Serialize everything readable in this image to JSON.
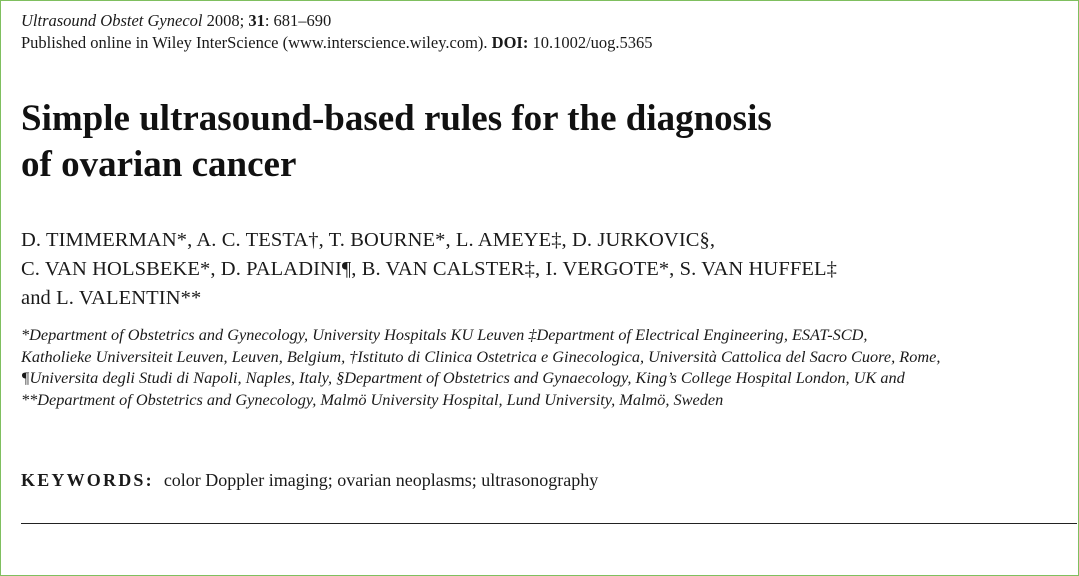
{
  "citation": {
    "journal": "Ultrasound Obstet Gynecol",
    "year": " 2008; ",
    "volume": "31",
    "pages": ": 681–690",
    "published": "Published online in Wiley InterScience (www.interscience.wiley.com). ",
    "doi_label": "DOI:",
    "doi_value": " 10.1002/uog.5365"
  },
  "title": {
    "line1": "Simple ultrasound-based rules for the diagnosis",
    "line2": "of ovarian cancer"
  },
  "authors": {
    "line1": "D. TIMMERMAN*, A. C. TESTA†, T. BOURNE*, L. AMEYE‡, D. JURKOVIC§,",
    "line2": "C. VAN HOLSBEKE*, D. PALADINI¶, B. VAN CALSTER‡, I. VERGOTE*, S. VAN HUFFEL‡",
    "line3": "and L. VALENTIN**"
  },
  "affiliations": {
    "line1": "*Department of Obstetrics and Gynecology, University Hospitals KU Leuven ‡Department of Electrical Engineering, ESAT-SCD,",
    "line2": "Katholieke Universiteit Leuven, Leuven, Belgium, †Istituto di Clinica Ostetrica e Ginecologica, Università Cattolica del Sacro Cuore, Rome,",
    "line3": "¶Universita degli Studi di Napoli, Naples, Italy, §Department of Obstetrics and Gynaecology, King’s College Hospital London, UK and",
    "line4": "**Department of Obstetrics and Gynecology, Malmö University Hospital, Lund University, Malmö, Sweden"
  },
  "keywords": {
    "label": "KEYWORDS:",
    "value": "color Doppler imaging; ovarian neoplasms; ultrasonography"
  }
}
